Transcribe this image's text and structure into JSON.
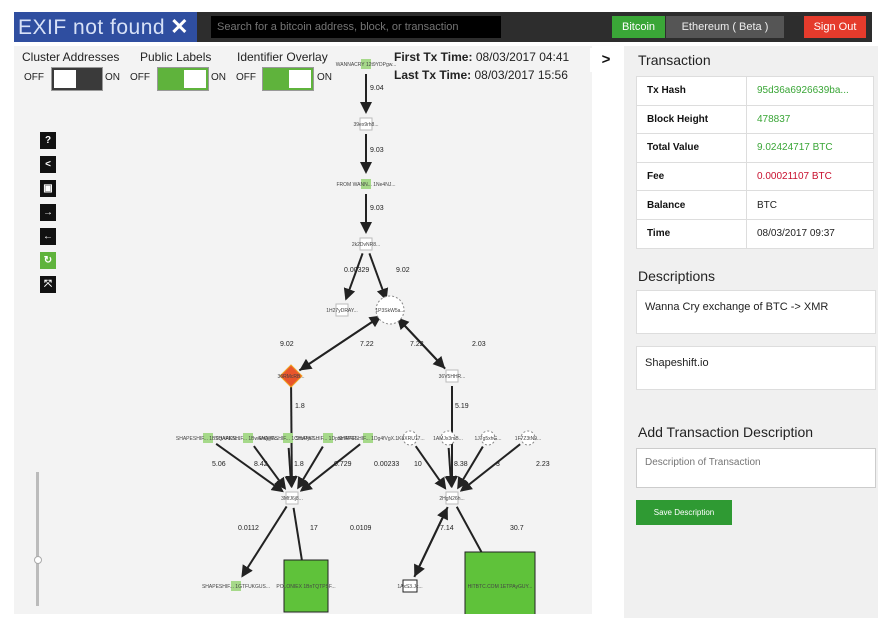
{
  "header": {
    "logo_text": "EXIF not found",
    "logo_close": "✕",
    "search_placeholder": "Search for a bitcoin address, block, or transaction",
    "btn_bitcoin": "Bitcoin",
    "btn_ethereum": "Ethereum ( Beta )",
    "btn_signout": "Sign Out",
    "colors": {
      "dark": "#2d2d2d",
      "brand": "#2f4ea0",
      "green": "#3aa637",
      "red": "#e53b2c"
    }
  },
  "toggles": [
    {
      "label": "Cluster Addresses",
      "off": "OFF",
      "on": "ON",
      "state": "off"
    },
    {
      "label": "Public Labels",
      "off": "OFF",
      "on": "ON",
      "state": "on"
    },
    {
      "label": "Identifier Overlay",
      "off": "OFF",
      "on": "ON",
      "state": "on"
    }
  ],
  "tx_times": {
    "first_label": "First Tx Time:",
    "first_value": "08/03/2017 04:41",
    "last_label": "Last Tx Time:",
    "last_value": "08/03/2017 15:56"
  },
  "toolbar": {
    "help": "?",
    "share": "<",
    "save": "▣",
    "forward": "→",
    "back": "←",
    "reset": "↻",
    "fullscreen": "⤧",
    "icons": [
      "help-icon",
      "share-icon",
      "save-icon",
      "forward-icon",
      "back-icon",
      "reset-icon",
      "fullscreen-icon"
    ]
  },
  "graph": {
    "nodes": [
      {
        "label": "WANNACRY 12t9YDPgw..."
      },
      {
        "label": "39ex9rh8..."
      },
      {
        "label": "FROM WANN... 1Ne4NJ..."
      },
      {
        "label": "2k2DvNR8..."
      },
      {
        "label": "1H27yDRAY..."
      },
      {
        "label": "1P3SkW5a..."
      },
      {
        "label": "36RMcRB..."
      },
      {
        "label": "36V5HHR..."
      },
      {
        "label": "SHAPESHIF... 1BTQAAKN..."
      },
      {
        "label": "SHAPESHIF... 1Bw4AQgPc..."
      },
      {
        "label": "SHAPESHIF... 1CHzPyrT..."
      },
      {
        "label": "SHAPESHIF... 1Dpsb7PRR..."
      },
      {
        "label": "SHAPESHIF... 1Dg4fVgX..."
      },
      {
        "label": "1K8XRU17..."
      },
      {
        "label": "1AMJx3mB..."
      },
      {
        "label": "1J7g5xhG..."
      },
      {
        "label": "1F7Z3tN9..."
      },
      {
        "label": "3MfJ6j8..."
      },
      {
        "label": "2HgN26h..."
      },
      {
        "label": "SHAPESHIF... 1GTFUKGUS..."
      },
      {
        "label": "POLONIEX 1BnTQTPSF..."
      },
      {
        "label": "1AxS3.Jc..."
      },
      {
        "label": "HITBTC.COM 1ETPAyGUY..."
      }
    ],
    "edges": [
      "9.04",
      "9.03",
      "9.03",
      "0.00329",
      "9.02",
      "9.02",
      "7.22",
      "7.22",
      "2.03",
      "1.8",
      "5.19",
      "5.06",
      "8.42",
      "1.8",
      "0.729",
      "0.00233",
      "10",
      "8.38",
      "3",
      "2.23",
      "0.0112",
      "17",
      "0.0109",
      "7.14",
      "30.7"
    ]
  },
  "panel": {
    "title": "Transaction",
    "collapse": ">",
    "rows": [
      {
        "key": "Tx Hash",
        "value": "95d36a6926639ba...",
        "color": "#3aa637"
      },
      {
        "key": "Block Height",
        "value": "478837",
        "color": "#3aa637"
      },
      {
        "key": "Total Value",
        "value": "9.02424717 BTC",
        "color": "#3aa637"
      },
      {
        "key": "Fee",
        "value": "0.00021107 BTC",
        "color": "#c8102e"
      },
      {
        "key": "Balance",
        "value": "BTC",
        "color": "#222222"
      },
      {
        "key": "Time",
        "value": "08/03/2017 09:37",
        "color": "#222222"
      }
    ],
    "descriptions_title": "Descriptions",
    "descriptions": [
      "Wanna Cry exchange of BTC -> XMR",
      "Shapeshift.io"
    ],
    "add_title": "Add Transaction Description",
    "input_placeholder": "Description of Transaction",
    "save_label": "Save Description"
  }
}
